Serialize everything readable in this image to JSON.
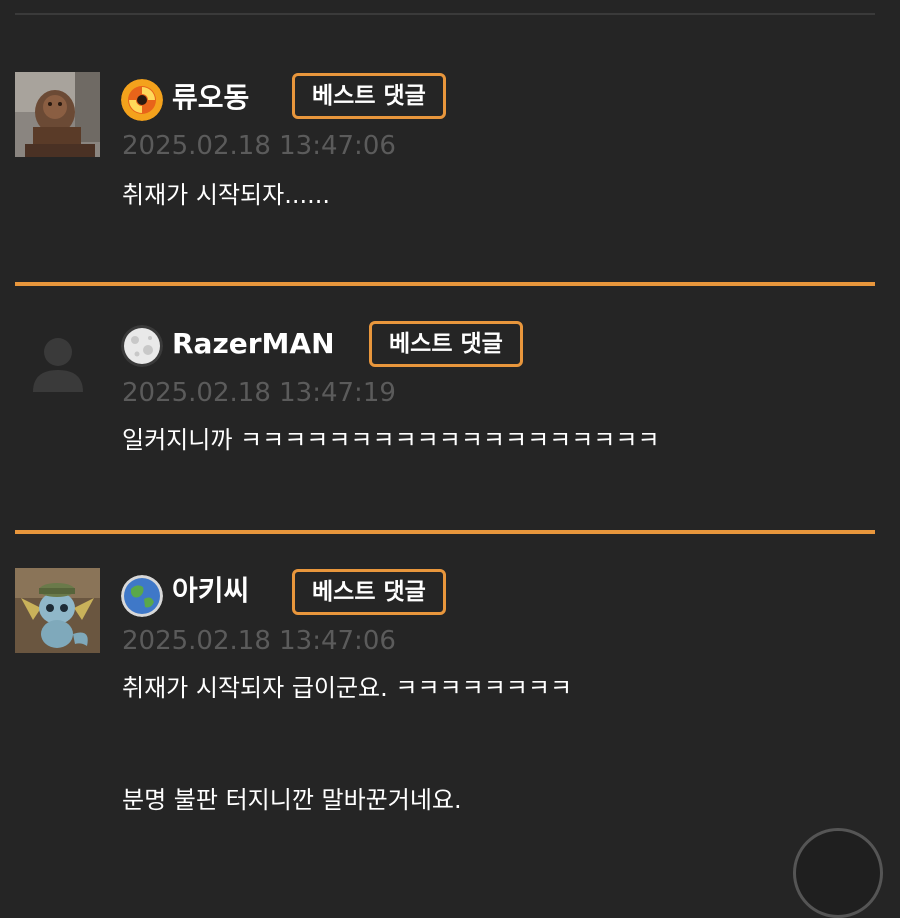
{
  "comments": [
    {
      "username": "류오동",
      "badge": "베스트 댓글",
      "timestamp": "2025.02.18 13:47:06",
      "lines": [
        "취재가 시작되자......"
      ],
      "level_icon": "flame-level-icon",
      "avatar": "lion-statue-avatar"
    },
    {
      "username": "RazerMAN",
      "badge": "베스트 댓글",
      "timestamp": "2025.02.18 13:47:19",
      "lines": [
        "일커지니까 ㅋㅋㅋㅋㅋㅋㅋㅋㅋㅋㅋㅋㅋㅋㅋㅋㅋㅋㅋ"
      ],
      "level_icon": "moon-level-icon",
      "avatar": "default-person-avatar"
    },
    {
      "username": "아키씨",
      "badge": "베스트 댓글",
      "timestamp": "2025.02.18 13:47:06",
      "lines": [
        "취재가 시작되자 급이군요. ㅋㅋㅋㅋㅋㅋㅋㅋ",
        "분명 불판 터지니깐 말바꾼거네요."
      ],
      "level_icon": "earth-level-icon",
      "avatar": "creature-avatar"
    }
  ],
  "colors": {
    "background": "#252525",
    "accent": "#e8963c",
    "timestamp": "#5b5b5b",
    "text": "#ffffff"
  }
}
